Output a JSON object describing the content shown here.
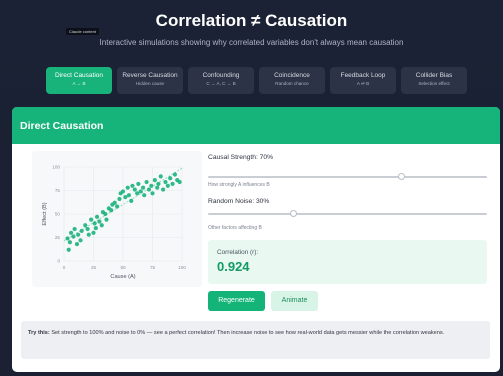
{
  "header": {
    "badge": "Claude content",
    "title": "Correlation ≠ Causation",
    "subtitle": "Interactive simulations showing why correlated variables don't always mean causation"
  },
  "tabs": [
    {
      "label": "Direct Causation",
      "sub": "A → B",
      "active": true
    },
    {
      "label": "Reverse Causation",
      "sub": "Hidden cause",
      "active": false
    },
    {
      "label": "Confounding",
      "sub": "C → A, C → B",
      "active": false
    },
    {
      "label": "Coincidence",
      "sub": "Random chance",
      "active": false
    },
    {
      "label": "Feedback Loop",
      "sub": "A ⇌ B",
      "active": false
    },
    {
      "label": "Collider Bias",
      "sub": "Selection effect",
      "active": false
    }
  ],
  "panel": {
    "title": "Direct Causation",
    "strength": {
      "label": "Causal Strength: 70%",
      "help": "How strongly A influences B",
      "value": 0.7
    },
    "noise": {
      "label": "Random Noise: 30%",
      "help": "Other factors affecting B",
      "value": 0.3
    },
    "correlation": {
      "label": "Correlation (r):",
      "value": "0.924"
    },
    "buttons": {
      "regenerate": "Regenerate",
      "animate": "Animate"
    },
    "tip": {
      "lead": "Try this:",
      "text": " Set strength to 100% and noise to 0% — see a perfect correlation! Then increase noise to see how real-world data gets messier while the correlation weakens."
    }
  },
  "chart_data": {
    "type": "scatter",
    "xlabel": "Cause (A)",
    "ylabel": "Effect (B)",
    "xlim": [
      0,
      100
    ],
    "ylim": [
      0,
      100
    ],
    "xticks": [
      "0",
      "25",
      "50",
      "75",
      "100"
    ],
    "yticks": [
      "0",
      "25",
      "50",
      "75",
      "100"
    ],
    "grid": true,
    "trendline": true,
    "colors": {
      "point": "#19b27b",
      "trend": "#8fdcbc"
    },
    "points": [
      [
        3,
        24
      ],
      [
        4,
        12
      ],
      [
        5,
        20
      ],
      [
        6,
        30
      ],
      [
        8,
        26
      ],
      [
        9,
        34
      ],
      [
        11,
        18
      ],
      [
        12,
        28
      ],
      [
        14,
        22
      ],
      [
        15,
        32
      ],
      [
        18,
        38
      ],
      [
        20,
        34
      ],
      [
        21,
        28
      ],
      [
        23,
        44
      ],
      [
        25,
        30
      ],
      [
        26,
        40
      ],
      [
        27,
        35
      ],
      [
        28,
        47
      ],
      [
        30,
        42
      ],
      [
        32,
        38
      ],
      [
        33,
        52
      ],
      [
        35,
        50
      ],
      [
        36,
        44
      ],
      [
        38,
        56
      ],
      [
        40,
        54
      ],
      [
        41,
        60
      ],
      [
        43,
        62
      ],
      [
        45,
        58
      ],
      [
        47,
        66
      ],
      [
        48,
        72
      ],
      [
        50,
        74
      ],
      [
        52,
        68
      ],
      [
        54,
        78
      ],
      [
        55,
        70
      ],
      [
        57,
        64
      ],
      [
        58,
        80
      ],
      [
        60,
        76
      ],
      [
        62,
        72
      ],
      [
        63,
        82
      ],
      [
        65,
        74
      ],
      [
        67,
        78
      ],
      [
        68,
        70
      ],
      [
        70,
        84
      ],
      [
        72,
        76
      ],
      [
        74,
        80
      ],
      [
        75,
        72
      ],
      [
        77,
        86
      ],
      [
        79,
        78
      ],
      [
        80,
        82
      ],
      [
        82,
        90
      ],
      [
        84,
        76
      ],
      [
        86,
        84
      ],
      [
        88,
        80
      ],
      [
        90,
        88
      ],
      [
        92,
        82
      ],
      [
        94,
        92
      ],
      [
        96,
        86
      ],
      [
        98,
        84
      ]
    ]
  }
}
